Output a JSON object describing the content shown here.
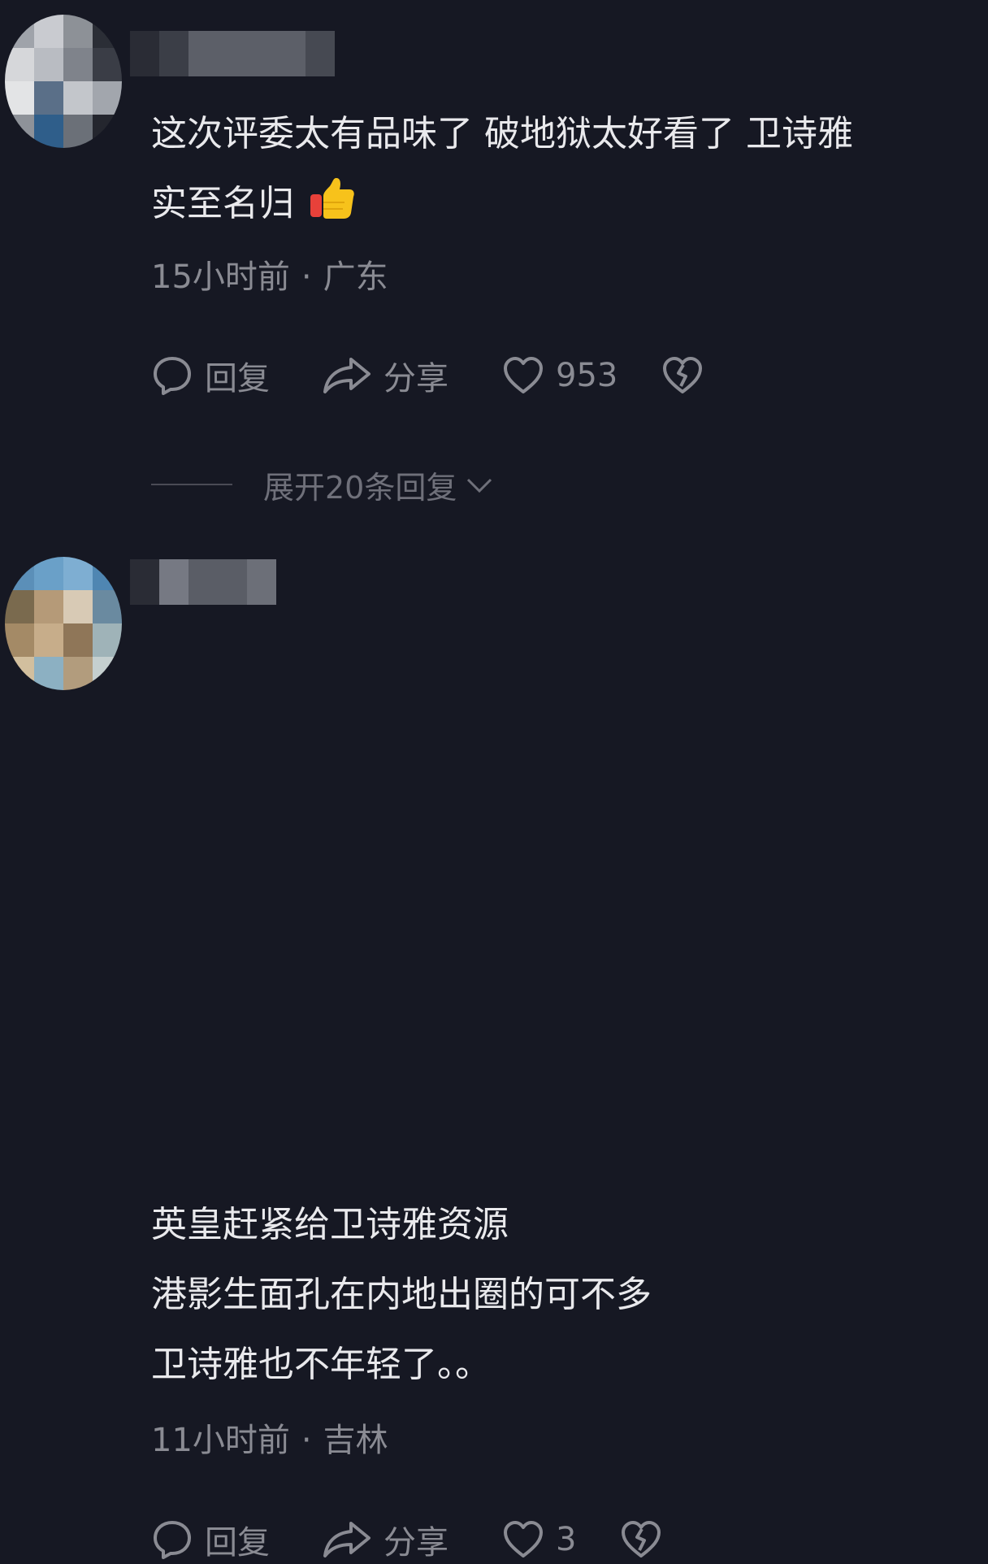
{
  "comments": [
    {
      "text_lines": [
        "这次评委太有品味了 破地狱太好看了 卫诗雅",
        "实至名归"
      ],
      "time": "15小时前",
      "location": "广东",
      "reply_label": "回复",
      "share_label": "分享",
      "like_count": "953",
      "expand_label": "展开20条回复"
    },
    {
      "text_lines": [
        "英皇赶紧给卫诗雅资源",
        "港影生面孔在内地出圈的可不多",
        "卫诗雅也不年轻了。。"
      ],
      "time": "11小时前",
      "location": "吉林",
      "reply_label": "回复",
      "share_label": "分享",
      "like_count": "3"
    }
  ],
  "colors": {
    "background": "#161823",
    "text": "#e9e9ec",
    "meta": "#8a8b93"
  }
}
